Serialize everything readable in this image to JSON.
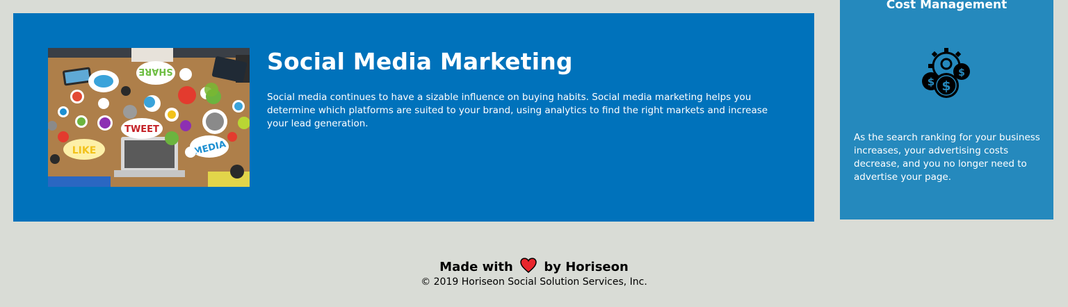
{
  "article": {
    "title": "Social Media Marketing",
    "body": "Social media continues to have a sizable influence on buying habits. Social media marketing helps you determine which platforms are suited to your brand, using analytics to find the right markets and increase your lead generation.",
    "image": {
      "bubble_labels": [
        "SHARE",
        "TWEET",
        "LIKE",
        "MEDIA"
      ]
    }
  },
  "benefit": {
    "title": "Cost Management",
    "icon": "cost-management-icon",
    "body": "As the search ranking for your business increases, your advertising costs decrease, and you no longer need to advertise your page."
  },
  "footer": {
    "made_prefix": "Made with",
    "made_suffix": "by Horiseon",
    "heart_icon": "heart-icon",
    "copyright": "© 2019 Horiseon Social Solution Services, Inc."
  },
  "colors": {
    "page_background": "#d9dcd6",
    "article_background": "#0072bb",
    "benefit_background": "#2589bd",
    "heart": "#e8262c"
  }
}
